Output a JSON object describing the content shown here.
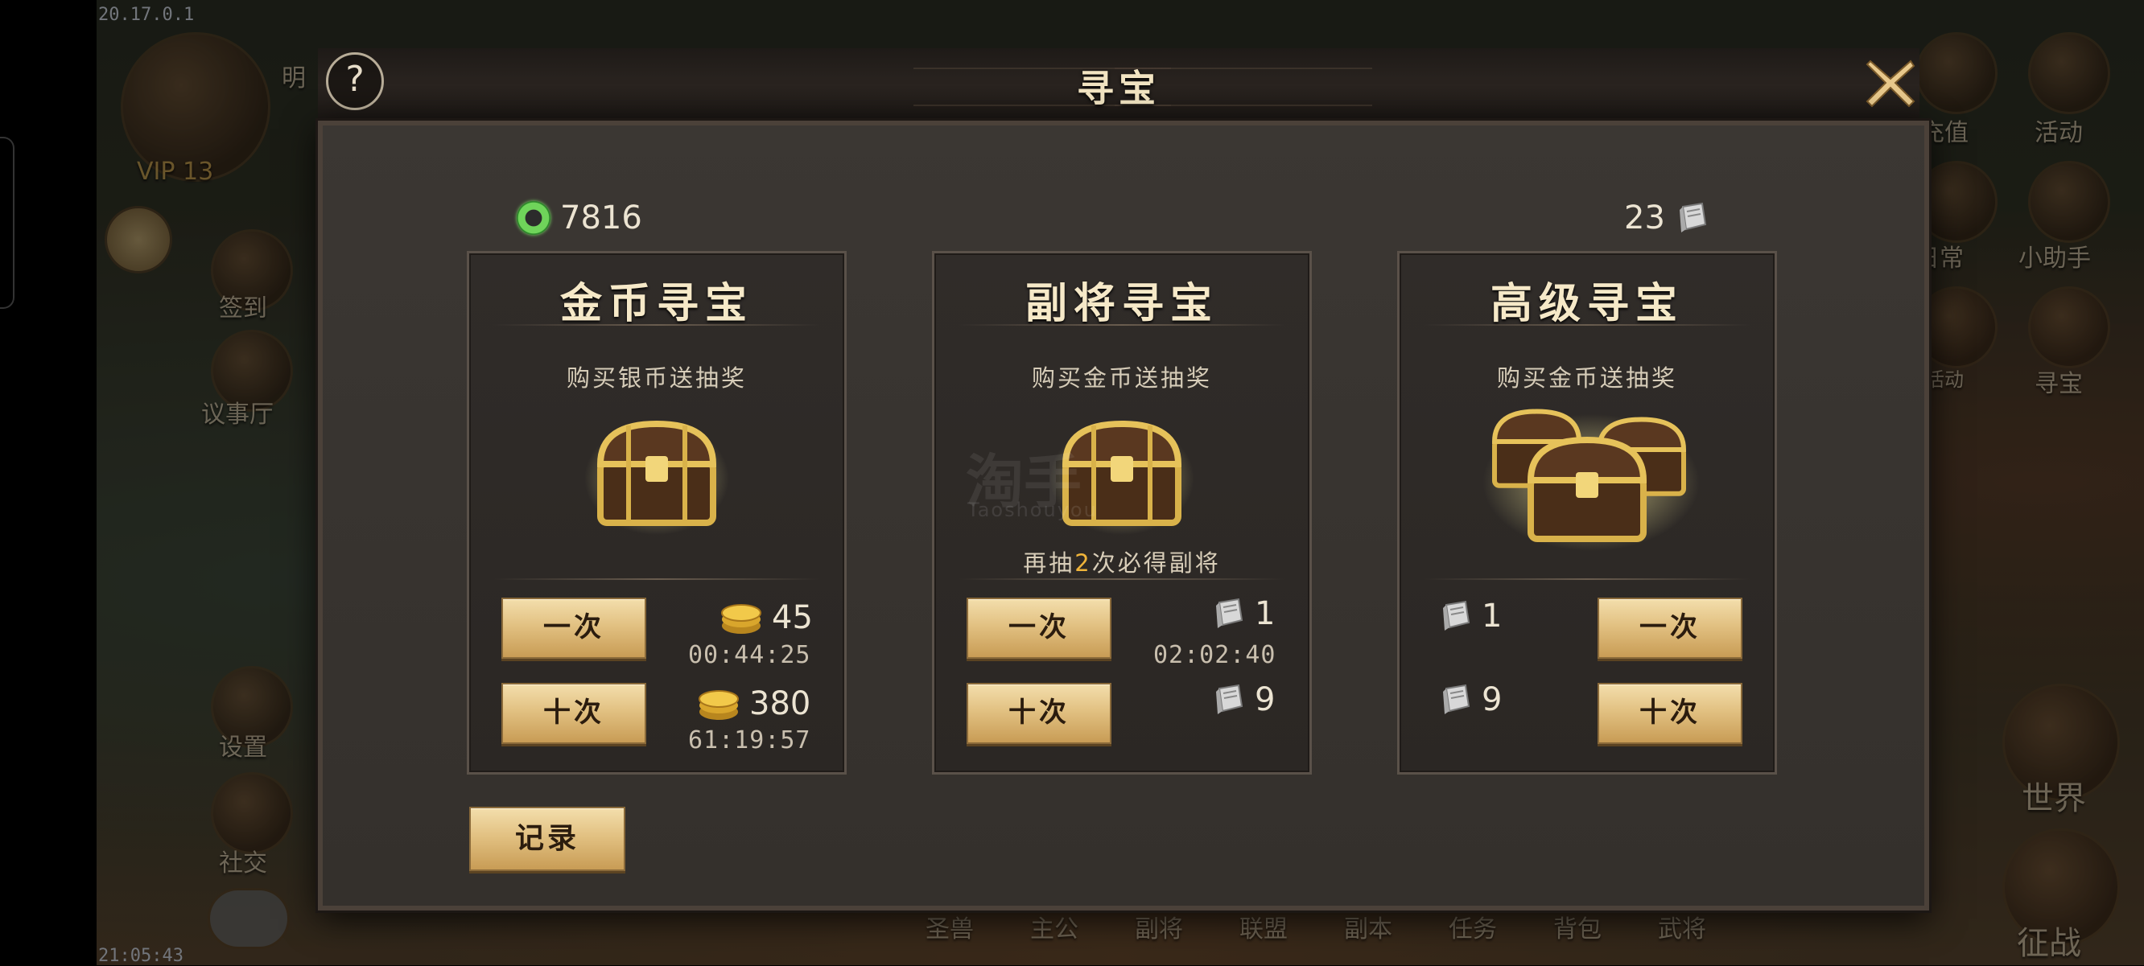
{
  "status_bar": {
    "ip": "20.17.0.1",
    "clock": "21:05:43"
  },
  "background_hud": {
    "player_name": "明",
    "vip": "VIP 13",
    "left_menu": [
      "签到",
      "议事厅",
      "设置",
      "社交"
    ],
    "right_menu": [
      "充值",
      "活动",
      "日常",
      "小助手",
      "活动",
      "寻宝",
      "世界",
      "征战"
    ],
    "bottom_menu": [
      "圣兽",
      "主公",
      "副将",
      "联盟",
      "副本",
      "任务",
      "背包",
      "武将"
    ]
  },
  "dialog": {
    "title": "寻宝",
    "help_label": "?",
    "currency_jade": "7816",
    "currency_scroll": "23",
    "record_label": "记录"
  },
  "cards": [
    {
      "title": "金币寻宝",
      "subtitle": "购买银币送抽奖",
      "once_label": "一次",
      "ten_label": "十次",
      "once_cost": "45",
      "once_timer": "00:44:25",
      "ten_cost": "380",
      "ten_timer": "61:19:57"
    },
    {
      "title": "副将寻宝",
      "subtitle": "购买金币送抽奖",
      "guarantee_pre": "再抽",
      "guarantee_num": "2",
      "guarantee_post": "次必得副将",
      "once_label": "一次",
      "ten_label": "十次",
      "once_cost": "1",
      "once_timer": "02:02:40",
      "ten_cost": "9"
    },
    {
      "title": "高级寻宝",
      "subtitle": "购买金币送抽奖",
      "once_label": "一次",
      "ten_label": "十次",
      "once_cost": "1",
      "ten_cost": "9"
    }
  ],
  "watermark": {
    "logo": "淘手",
    "text": "Taoshouyou"
  },
  "colors": {
    "gold_button": "#e2c182",
    "accent_orange": "#f0b43a",
    "jade_green": "#6fd45a"
  }
}
